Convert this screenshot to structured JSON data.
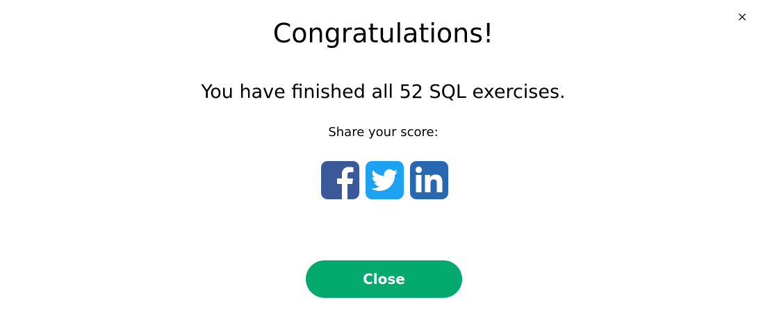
{
  "modal": {
    "close_icon_glyph": "×",
    "title": "Congratulations!",
    "message": "You have finished all 52 SQL exercises.",
    "share_label": "Share your score:",
    "social": [
      {
        "icon": "facebook-icon",
        "color": "#3b5998"
      },
      {
        "icon": "twitter-icon",
        "color": "#1da1f2"
      },
      {
        "icon": "linkedin-icon",
        "color": "#2867b2"
      }
    ],
    "close_button_label": "Close",
    "close_button_color": "#04aa6d"
  }
}
